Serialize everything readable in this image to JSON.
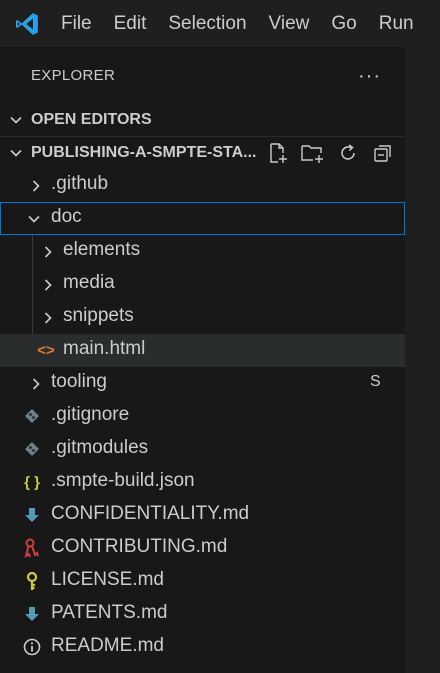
{
  "menu": [
    "File",
    "Edit",
    "Selection",
    "View",
    "Go",
    "Run"
  ],
  "explorer": {
    "title": "EXPLORER",
    "more": "···"
  },
  "sections": {
    "open_editors": "OPEN EDITORS",
    "project": "PUBLISHING-A-SMPTE-STA..."
  },
  "tree": {
    "github": ".github",
    "doc": "doc",
    "elements": "elements",
    "media": "media",
    "snippets": "snippets",
    "main_html": "main.html",
    "tooling": "tooling",
    "tooling_badge": "S",
    "gitignore": ".gitignore",
    "gitmodules": ".gitmodules",
    "smpte_build": ".smpte-build.json",
    "confidentiality": "CONFIDENTIALITY.md",
    "contributing": "CONTRIBUTING.md",
    "license": "LICENSE.md",
    "patents": "PATENTS.md",
    "readme": "README.md"
  },
  "colors": {
    "accent": "#0078d4",
    "html_icon": "#e37933",
    "json_icon": "#cbcb41",
    "md_blue": "#519aba",
    "md_red": "#cc3e44",
    "md_yellow": "#cbcb41"
  }
}
